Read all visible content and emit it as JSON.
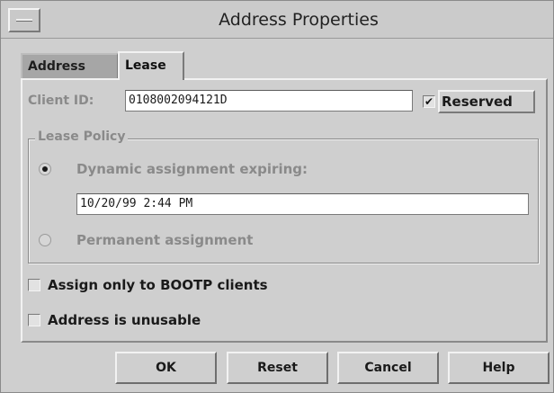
{
  "window": {
    "title": "Address Properties"
  },
  "tabs": [
    {
      "label": "Address",
      "selected": false
    },
    {
      "label": "Lease",
      "selected": true
    }
  ],
  "client_id": {
    "label": "Client ID:",
    "value": "0108002094121D"
  },
  "reserved": {
    "label": "Reserved",
    "checked": true,
    "mark": "✔"
  },
  "lease_policy": {
    "title": "Lease Policy",
    "dynamic": {
      "label": "Dynamic assignment expiring:",
      "selected": true
    },
    "expiry": {
      "value": "10/20/99 2:44 PM"
    },
    "permanent": {
      "label": "Permanent assignment",
      "selected": false
    }
  },
  "options": {
    "bootp": {
      "label": "Assign only to BOOTP clients",
      "checked": false
    },
    "unusable": {
      "label": "Address is unusable",
      "checked": false
    }
  },
  "buttons": {
    "ok": "OK",
    "reset": "Reset",
    "cancel": "Cancel",
    "help": "Help"
  },
  "icons": {
    "window_menu": "window-menu-icon",
    "checkbox": "check-icon",
    "radio": "radio-icon"
  }
}
